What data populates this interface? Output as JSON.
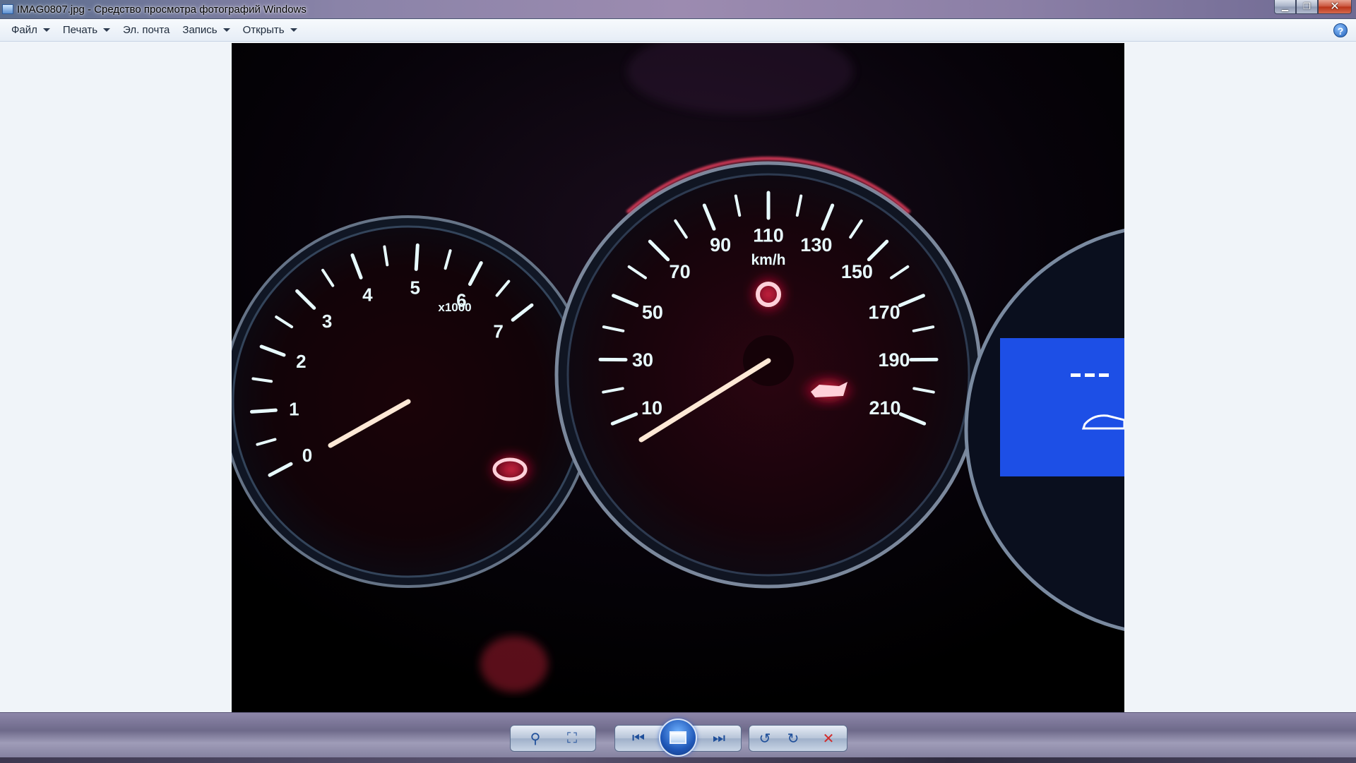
{
  "window": {
    "title": "IMAG0807.jpg - Средство просмотра фотографий Windows",
    "min_glyph": "▁",
    "max_glyph": "❐",
    "close_glyph": "✕"
  },
  "menu": {
    "items": [
      {
        "label": "Файл",
        "has_dropdown": true
      },
      {
        "label": "Печать",
        "has_dropdown": true
      },
      {
        "label": "Эл. почта",
        "has_dropdown": false
      },
      {
        "label": "Запись",
        "has_dropdown": true
      },
      {
        "label": "Открыть",
        "has_dropdown": true
      }
    ],
    "help_glyph": "?"
  },
  "photo": {
    "tachometer": {
      "labels": [
        "0",
        "1",
        "2",
        "3",
        "4",
        "5",
        "6",
        "7"
      ],
      "unit": "x1000",
      "needle_value": 0.6
    },
    "speedometer": {
      "labels": [
        "10",
        "30",
        "50",
        "70",
        "90",
        "110",
        "130",
        "150",
        "170",
        "190",
        "210"
      ],
      "unit": "km/h",
      "needle_value": 0
    },
    "colors": {
      "gauge_white": "#e8fbff",
      "gauge_glow": "#6fd8ff",
      "needle": "#ffe9d6",
      "warning_red": "#ff2a4a",
      "display_blue": "#1d4fe6"
    }
  },
  "controls": {
    "zoom_glyph": "⚲",
    "fit_glyph": "⛶",
    "prev_glyph": "⏮",
    "next_glyph": "⏭",
    "rotate_ccw_glyph": "↺",
    "rotate_cw_glyph": "↻",
    "delete_glyph": "✕"
  }
}
